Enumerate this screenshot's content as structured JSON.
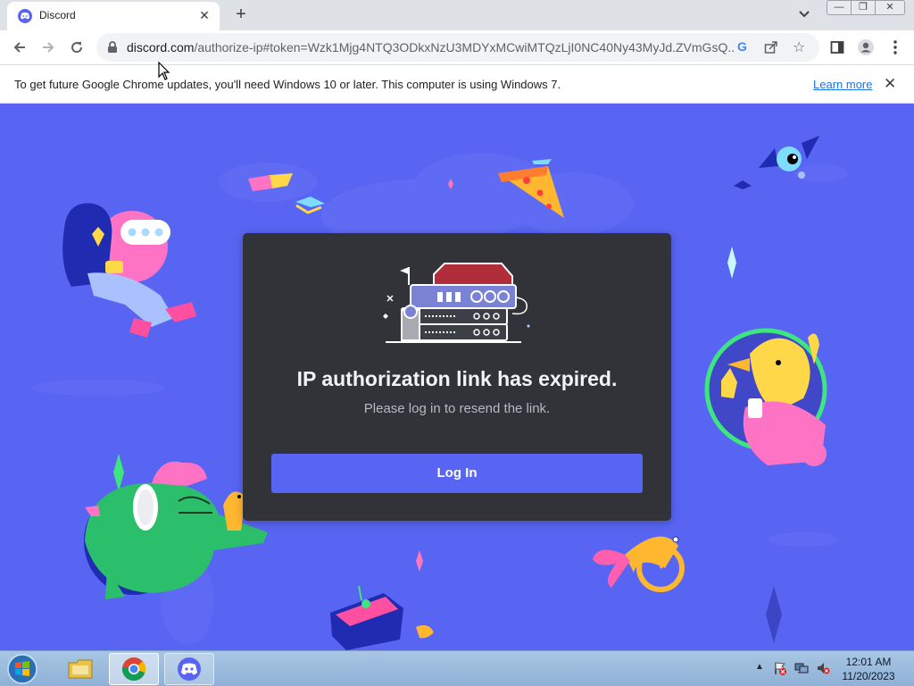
{
  "browser": {
    "tab_title": "Discord",
    "tab_close": "✕",
    "new_tab": "+",
    "window_controls": {
      "minimize": "—",
      "maximize": "❐",
      "close": "✕"
    },
    "url_host": "discord.com",
    "url_path": "/authorize-ip#token=Wzk1Mjg4NTQ3ODkxNzU3MDYxMCwiMTQzLjI0NC40Ny43MyJd.ZVmGsQ...",
    "infobar_message": "To get future Google Chrome updates, you'll need Windows 10 or later. This computer is using Windows 7.",
    "infobar_link": "Learn more",
    "infobar_close": "✕"
  },
  "page": {
    "heading": "IP authorization link has expired.",
    "subtext": "Please log in to resend the link.",
    "login_button": "Log In"
  },
  "taskbar": {
    "clock_time": "12:01 AM",
    "clock_date": "11/20/2023",
    "tray_expand": "▲"
  },
  "colors": {
    "discord_blurple": "#5865f2",
    "card_background": "#313338",
    "heading_text": "#f2f3f5",
    "subtext": "#b5bac1"
  },
  "icons": [
    "discord-favicon",
    "back-arrow-icon",
    "forward-arrow-icon",
    "reload-icon",
    "lock-icon",
    "google-icon",
    "share-icon",
    "star-icon",
    "side-panel-icon",
    "profile-icon",
    "menu-dots-icon",
    "windows-start-icon",
    "file-explorer-icon",
    "chrome-icon",
    "discord-icon"
  ]
}
